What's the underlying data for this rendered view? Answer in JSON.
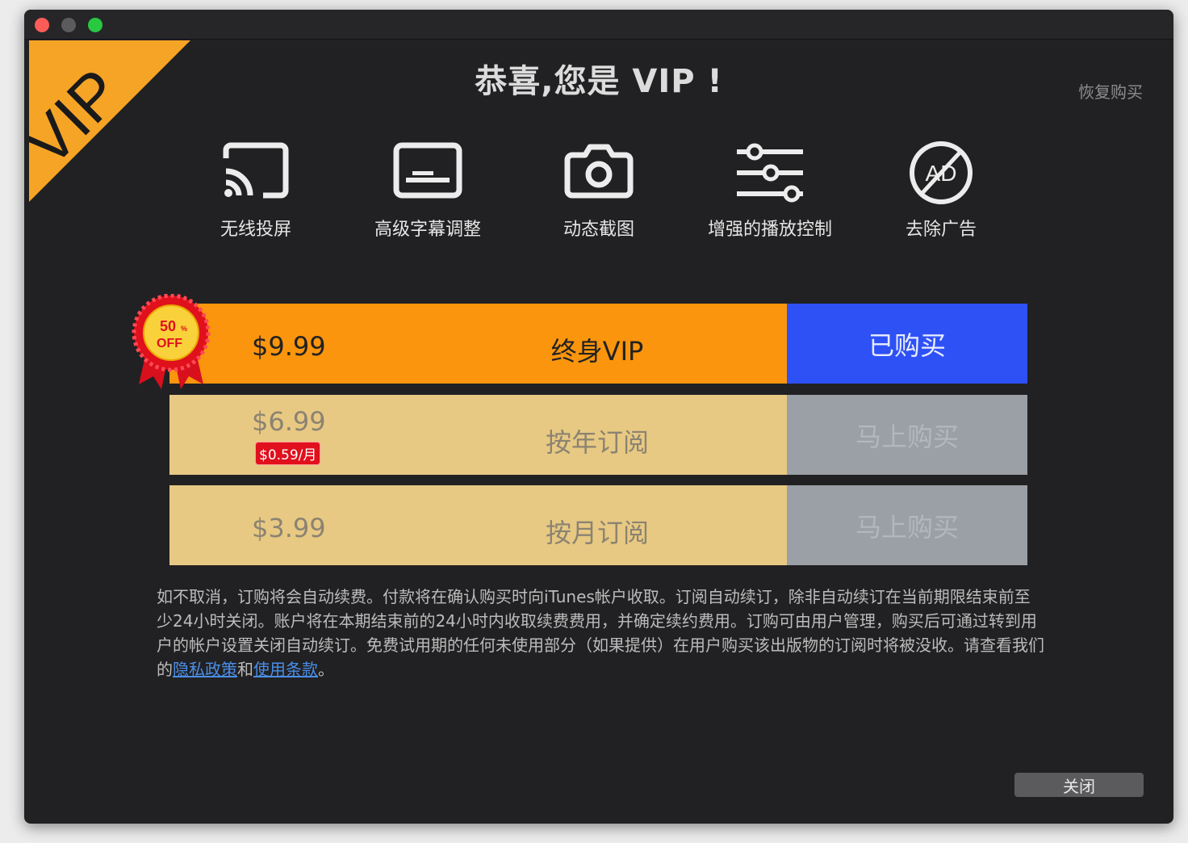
{
  "ribbon": {
    "label": "VIP"
  },
  "title": "恭喜,您是 VIP !",
  "restore_label": "恢复购买",
  "features": [
    {
      "icon": "cast-icon",
      "label": "无线投屏"
    },
    {
      "icon": "subtitles-icon",
      "label": "高级字幕调整"
    },
    {
      "icon": "camera-icon",
      "label": "动态截图"
    },
    {
      "icon": "sliders-icon",
      "label": "增强的播放控制"
    },
    {
      "icon": "no-ads-icon",
      "label": "去除广告",
      "icon_text": "AD"
    }
  ],
  "badge": {
    "line1": "50",
    "percent": "%",
    "line2": "OFF"
  },
  "plans": [
    {
      "price": "$9.99",
      "name": "终身VIP",
      "action": "已购买"
    },
    {
      "price": "$6.99",
      "per_month": "$0.59/月",
      "name": "按年订阅",
      "action": "马上购买"
    },
    {
      "price": "$3.99",
      "name": "按月订阅",
      "action": "马上购买"
    }
  ],
  "terms": {
    "text": "如不取消，订购将会自动续费。付款将在确认购买时向iTunes帐户收取。订阅自动续订，除非自动续订在当前期限结束前至少24小时关闭。账户将在本期结束前的24小时内收取续费费用，并确定续约费用。订购可由用户管理，购买后可通过转到用户的帐户设置关闭自动续订。免费试用期的任何未使用部分（如果提供）在用户购买该出版物的订阅时将被没收。请查看我们的",
    "privacy_link": "隐私政策",
    "and": "和",
    "terms_link": "使用条款",
    "end": "。"
  },
  "close_label": "关闭",
  "colors": {
    "window_bg": "#212123",
    "ribbon": "#f6a426",
    "lifetime_bg": "#fb950d",
    "purchased_bg": "#2e51f6",
    "plan_bg": "#e8c983",
    "buy_disabled_bg": "#9aa0a6",
    "badge_red": "#e0101d"
  }
}
